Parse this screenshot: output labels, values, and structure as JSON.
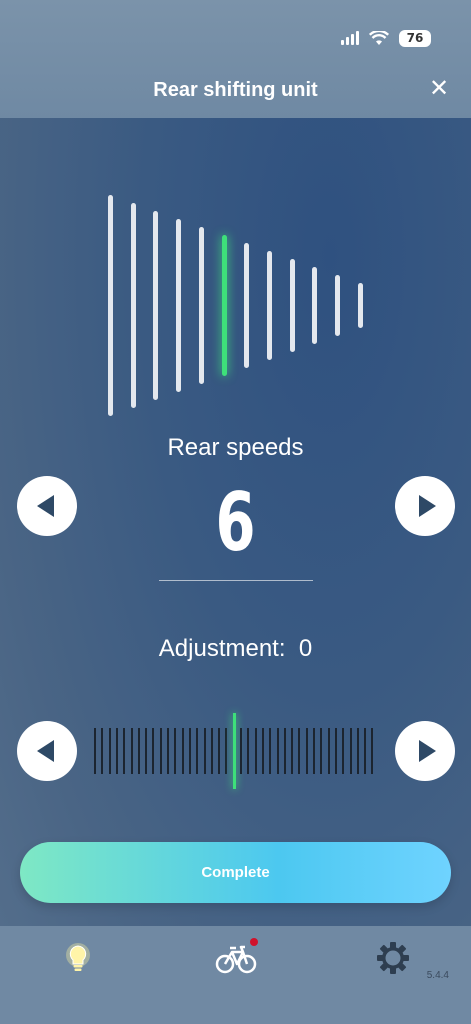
{
  "status_bar": {
    "battery": "76"
  },
  "header": {
    "title": "Rear shifting unit",
    "close_icon": "close-icon"
  },
  "rear_speeds": {
    "label": "Rear speeds",
    "value": "6",
    "gear_count": 12,
    "active_gear": 6
  },
  "adjustment": {
    "label": "Adjustment:",
    "value": "0",
    "tick_count": 39,
    "active_tick": 20
  },
  "buttons": {
    "prev_icon": "triangle-left-icon",
    "next_icon": "triangle-right-icon",
    "complete_label": "Complete"
  },
  "bottom_nav": {
    "items": [
      {
        "icon": "lightbulb-icon",
        "active": true
      },
      {
        "icon": "bicycle-icon",
        "badge": true
      },
      {
        "icon": "gear-icon"
      }
    ],
    "version": "5.4.4"
  },
  "colors": {
    "accent": "#3ee07a",
    "button_start": "#7ee8c4",
    "button_end": "#6fd3ff"
  }
}
